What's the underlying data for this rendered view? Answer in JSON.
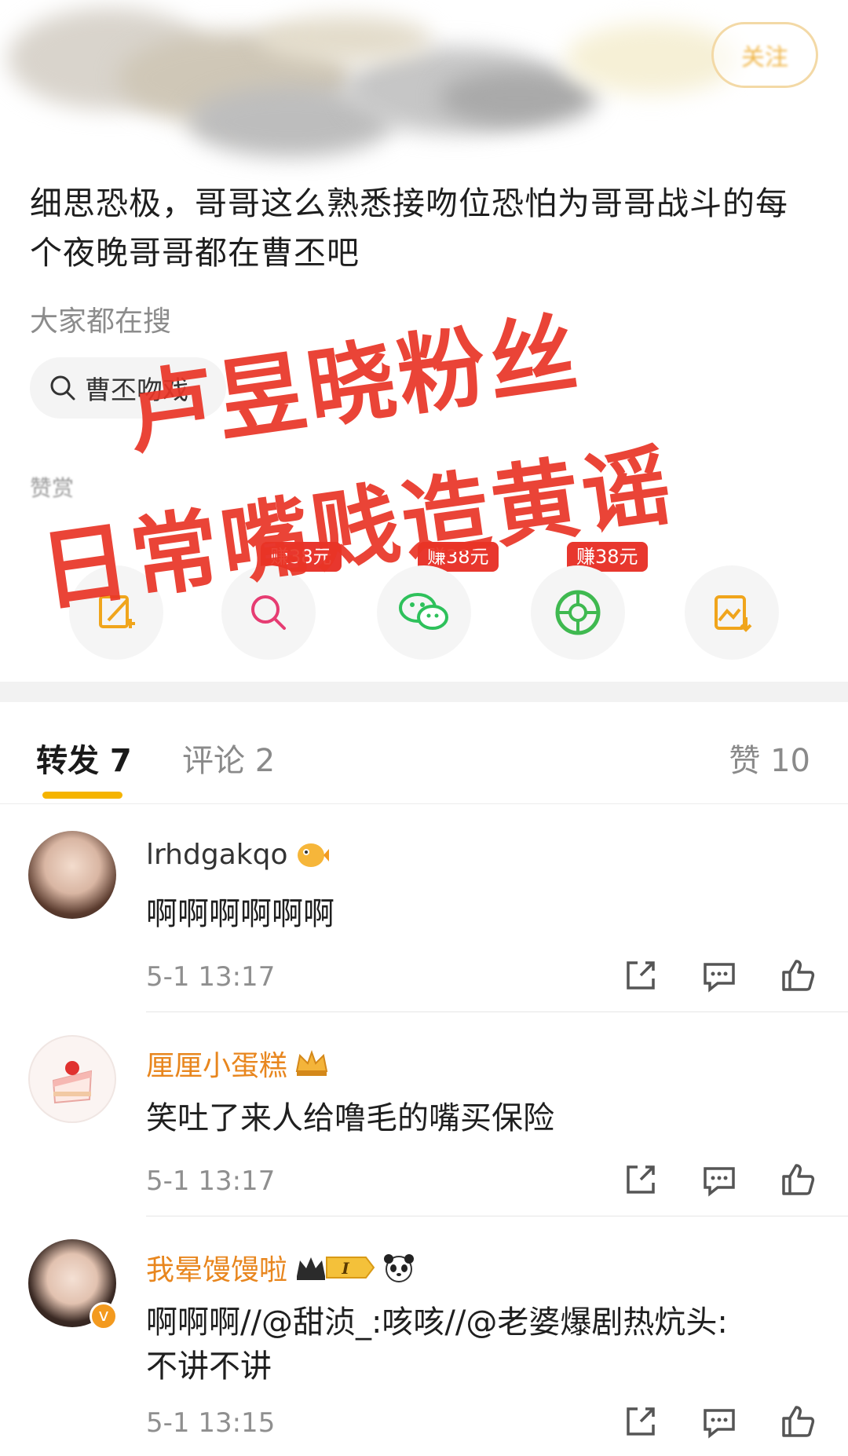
{
  "header": {
    "follow_label": "关注"
  },
  "post": {
    "text": "细思恐极，哥哥这么熟悉接吻位恐怕为哥哥战斗的每个夜晚哥哥都在曹丕吧"
  },
  "hot_search": {
    "label": "大家都在搜",
    "chip_text": "曹丕吻戏"
  },
  "reward_text": "赞赏",
  "share": {
    "badges": [
      "赚38元",
      "赚38元",
      "赚38元"
    ],
    "icons": [
      "edit-icon",
      "search-share-icon",
      "wechat-icon",
      "moments-icon",
      "save-image-icon"
    ]
  },
  "tabs": {
    "repost": "转发 7",
    "comment": "评论 2",
    "like": "赞 10"
  },
  "comments": [
    {
      "name": "lrhdgakqo",
      "badge": "pufferfish-emoji-icon",
      "text": "啊啊啊啊啊啊",
      "time": "5-1 13:17"
    },
    {
      "name": "厘厘小蛋糕",
      "badge": "crown-badge-icon",
      "text": "笑吐了来人给噜毛的嘴买保险",
      "time": "5-1 13:17"
    },
    {
      "name": "我晕馒馒啦",
      "badge": "vip-level-badge-icon",
      "text": "啊啊啊//@甜浈_:咳咳//@老婆爆剧热炕头:不讲不讲",
      "time": "5-1 13:15"
    }
  ],
  "watermark": {
    "line1": "卢昱晓粉丝",
    "line2": "日常嘴贱造黄谣"
  },
  "colors": {
    "accent": "#f5b400",
    "vip_name": "#e8861e",
    "watermark": "#e83426",
    "earn_badge": "#e8372e"
  }
}
